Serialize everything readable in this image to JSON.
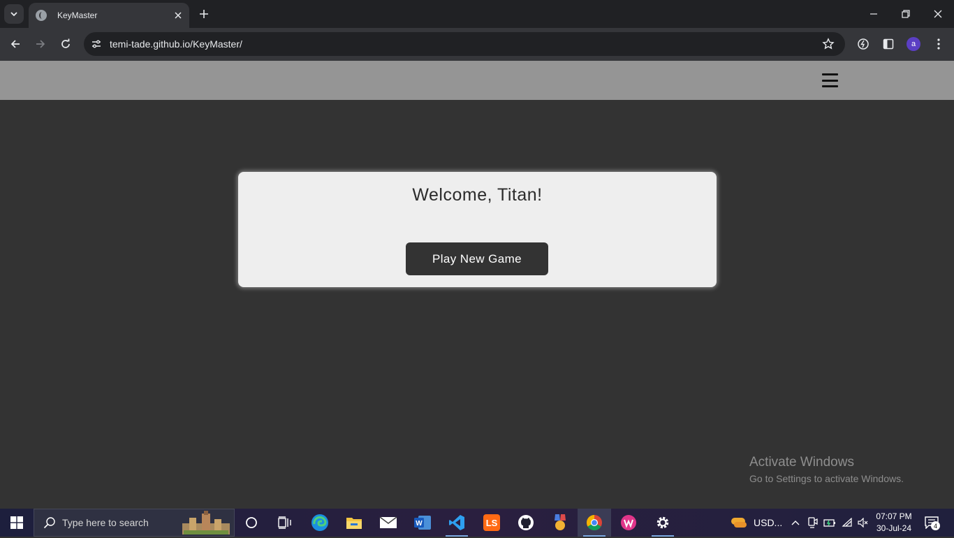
{
  "browser": {
    "tab": {
      "title": "KeyMaster"
    },
    "address_bar": {
      "url": "temi-tade.github.io/KeyMaster/"
    },
    "profile_initial": "a"
  },
  "page": {
    "welcome_heading": "Welcome, Titan!",
    "play_button_label": "Play New Game"
  },
  "watermark": {
    "title": "Activate Windows",
    "subtitle": "Go to Settings to activate Windows."
  },
  "taskbar": {
    "search_placeholder": "Type here to search",
    "weather_label": "USD...",
    "time": "07:07 PM",
    "date": "30-Jul-24",
    "notification_count": "4"
  },
  "colors": {
    "page_background": "#333333",
    "site_header": "#959595",
    "card_background": "#eeeeee",
    "button_background": "#333333"
  }
}
